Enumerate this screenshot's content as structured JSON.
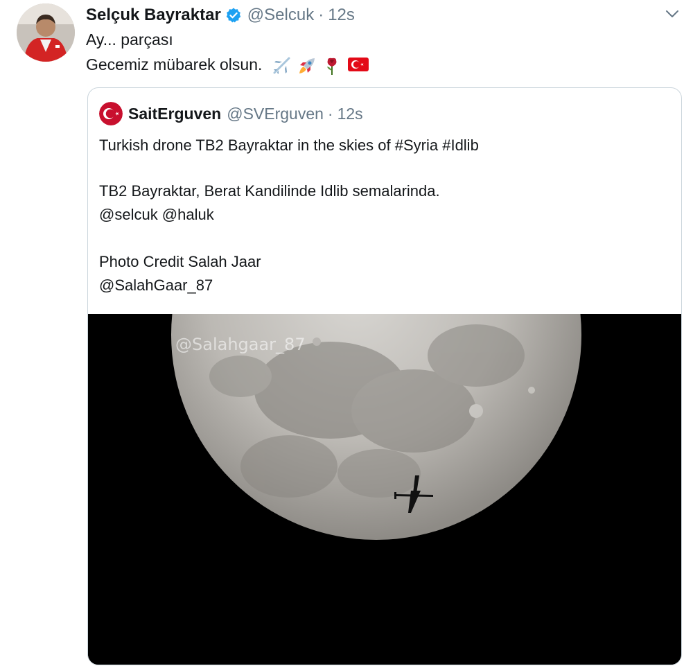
{
  "tweet": {
    "author_name": "Selçuk Bayraktar",
    "author_handle": "@Selcuk",
    "separator": "·",
    "time": "12s",
    "line1": "Ay... parçası",
    "line2": "Gecemiz mübarek olsun.",
    "emojis": [
      "airplane",
      "rocket",
      "rose",
      "turkey-flag"
    ],
    "colors": {
      "verified": "#1da1f2",
      "secondary_text": "#657786",
      "border": "#ccd6dd"
    }
  },
  "quote": {
    "author_name": "SaitErguven",
    "author_handle": "@SVErguven",
    "separator": "·",
    "time": "12s",
    "line1": "Turkish drone TB2 Bayraktar in the skies of #Syria #Idlib",
    "line2": "TB2 Bayraktar, Berat Kandilinde Idlib semalarinda.",
    "line3": "@selcuk @haluk",
    "line4": "Photo Credit Salah Jaar",
    "line5": "@SalahGaar_87",
    "media": {
      "watermark": "@Salahgaar_87"
    }
  }
}
